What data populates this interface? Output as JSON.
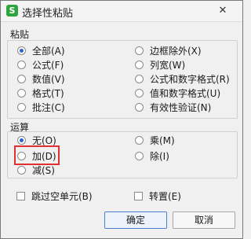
{
  "window": {
    "title": "选择性粘贴",
    "app_icon": "S",
    "close_glyph": "✕"
  },
  "paste": {
    "label": "粘贴",
    "options": [
      {
        "label": "全部(A)",
        "selected": true
      },
      {
        "label": "公式(F)",
        "selected": false
      },
      {
        "label": "数值(V)",
        "selected": false
      },
      {
        "label": "格式(T)",
        "selected": false
      },
      {
        "label": "批注(C)",
        "selected": false
      },
      {
        "label": "边框除外(X)",
        "selected": false
      },
      {
        "label": "列宽(W)",
        "selected": false
      },
      {
        "label": "公式和数字格式(R)",
        "selected": false
      },
      {
        "label": "值和数字格式(U)",
        "selected": false
      },
      {
        "label": "有效性验证(N)",
        "selected": false
      }
    ]
  },
  "operation": {
    "label": "运算",
    "options": [
      {
        "label": "无(O)",
        "selected": true
      },
      {
        "label": "加(D)",
        "selected": false
      },
      {
        "label": "减(S)",
        "selected": false
      },
      {
        "label": "乘(M)",
        "selected": false
      },
      {
        "label": "除(I)",
        "selected": false
      }
    ]
  },
  "checkboxes": [
    {
      "label": "跳过空单元(B)",
      "checked": false
    },
    {
      "label": "转置(E)",
      "checked": false
    }
  ],
  "buttons": {
    "ok": "确定",
    "cancel": "取消"
  },
  "colors": {
    "highlight": "#e03030",
    "radio_selected": "#2a66c9",
    "app_icon": "#2ea53e"
  }
}
